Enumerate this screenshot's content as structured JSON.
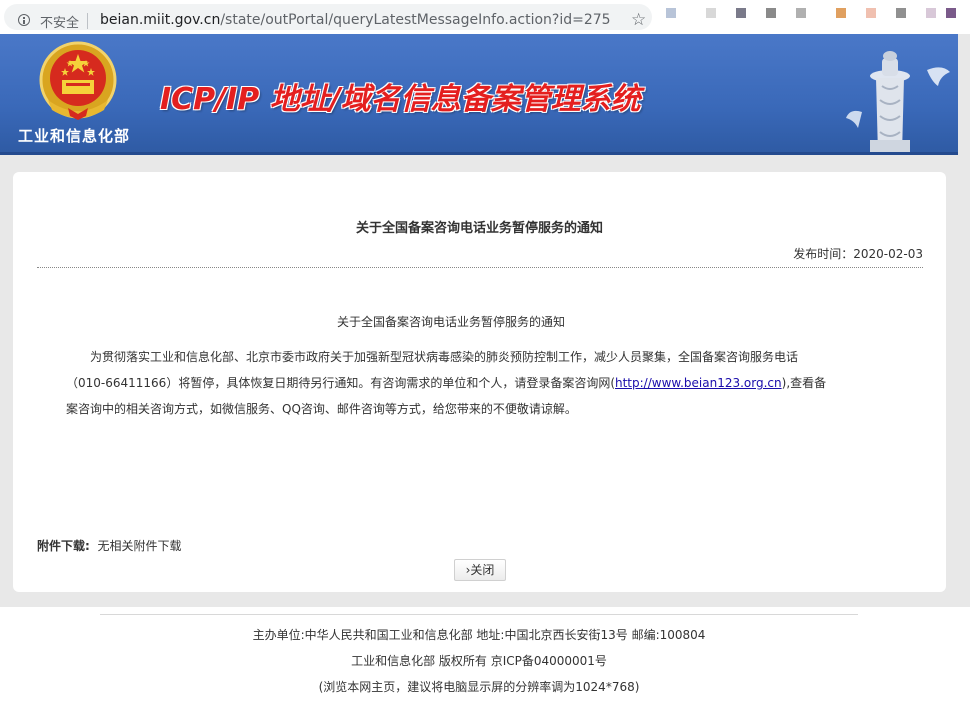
{
  "browser": {
    "security_label": "不安全",
    "url_host": "beian.miit.gov.cn",
    "url_path": "/state/outPortal/queryLatestMessageInfo.action?id=275",
    "extension_colors": [
      "#b8c4d8",
      "#d8d8d8",
      "#7a7a8a",
      "#8a8a8a",
      "#b0b0b0",
      "#e0a060",
      "#f0c0b0",
      "#909090",
      "#d8c8d8",
      "#7a5a8a"
    ]
  },
  "header": {
    "ministry_label": "工业和信息化部",
    "system_title": "ICP/IP 地址/域名信息备案管理系统",
    "accent_color": "#e41f1f",
    "banner_color": "#3a69b9"
  },
  "notice": {
    "title": "关于全国备案咨询电话业务暂停服务的通知",
    "publish_label": "发布时间：2020-02-03",
    "inner_title": "关于全国备案咨询电话业务暂停服务的通知",
    "body_part1": "为贯彻落实工业和信息化部、北京市委市政府关于加强新型冠状病毒感染的肺炎预防控制工作，减少人员聚集，全国备案咨询服务电话（010-66411166）将暂停，具体恢复日期待另行通知。有咨询需求的单位和个人，请登录备案咨询网(",
    "body_link": "http://www.beian123.org.cn",
    "body_part2": "),查看备案咨询中的相关咨询方式，如微信服务、QQ咨询、邮件咨询等方式，给您带来的不便敬请谅解。",
    "attachment_label": "附件下载:",
    "attachment_value": "无相关附件下载",
    "close_label": "关闭"
  },
  "footer": {
    "line1": "主办单位:中华人民共和国工业和信息化部 地址:中国北京西长安街13号 邮编:100804",
    "line2": "工业和信息化部 版权所有 京ICP备04000001号",
    "line3": "(浏览本网主页，建议将电脑显示屏的分辨率调为1024*768)"
  }
}
